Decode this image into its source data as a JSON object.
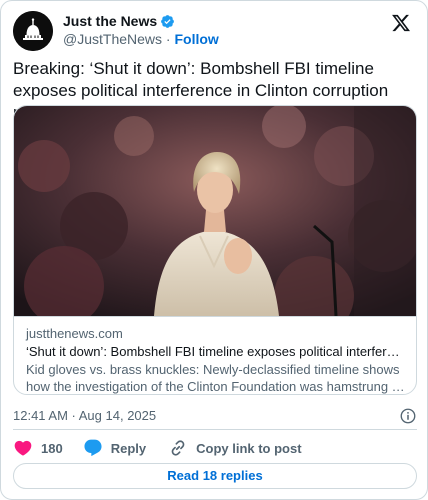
{
  "author": {
    "name": "Just the News",
    "handle": "@JustTheNews",
    "separator": "·",
    "follow_label": "Follow"
  },
  "tweet": {
    "text": "Breaking: ‘Shut it down’: Bombshell FBI timeline exposes political interference in Clinton corruption probe"
  },
  "link_card": {
    "domain": "justthenews.com",
    "title": "‘Shut it down’: Bombshell FBI timeline exposes political interference in …",
    "description": "Kid gloves vs. brass knuckles: Newly-declassified timeline shows how the investigation of the Clinton Foundation was hamstrung by FBI and DOJ…"
  },
  "timestamp": "12:41 AM · Aug 14, 2025",
  "actions": {
    "like_count": "180",
    "reply_label": "Reply",
    "copy_label": "Copy link to post"
  },
  "replies_button": "Read 18 replies",
  "colors": {
    "accent": "#006fd6",
    "verified": "#1d9bf0",
    "like": "#f91880",
    "reply": "#1d9bf0",
    "muted": "#536471",
    "border": "#cfd9de"
  },
  "icons": [
    "capitol-logo-icon",
    "verified-badge-icon",
    "x-logo-icon",
    "info-icon",
    "heart-icon",
    "reply-bubble-icon",
    "link-icon"
  ]
}
